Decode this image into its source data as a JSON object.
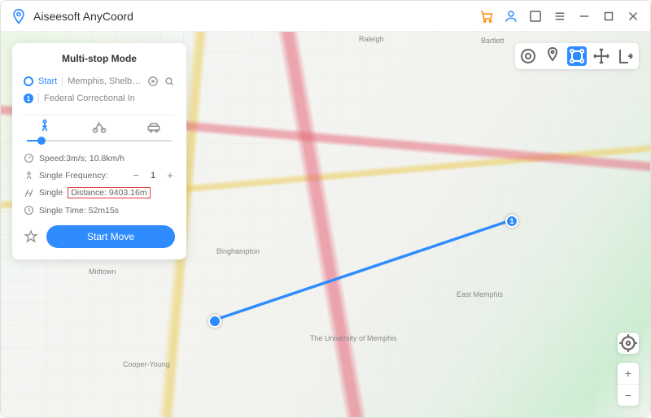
{
  "app": {
    "title": "Aiseesoft AnyCoord"
  },
  "panel": {
    "title": "Multi-stop Mode",
    "start_label": "Start",
    "start_value": "Memphis, Shelby Cour",
    "stop1_number": "1",
    "stop1_value": "Federal Correctional In",
    "speed_label": "Speed:3m/s; 10.8km/h",
    "freq_label": "Single Frequency:",
    "freq_value": "1",
    "distance_prefix": "Single",
    "distance_text": "Distance: 9403.16m",
    "time_label": "Single Time: 52m15s",
    "start_move": "Start Move"
  },
  "tooltips": {
    "location": "location",
    "locationpin": "location-pin",
    "multistop": "multi-stop",
    "move": "move",
    "export": "export"
  },
  "map_labels": {
    "raleigh": "Raleigh",
    "bartlett": "Bartlett",
    "midtown": "Midtown",
    "eastmemphis": "East Memphis",
    "cooper": "Cooper-Young",
    "binghampton": "Binghampton",
    "univ": "The University of Memphis"
  }
}
